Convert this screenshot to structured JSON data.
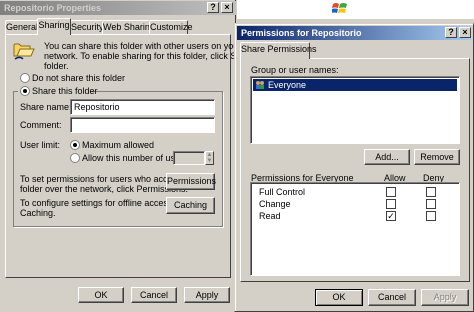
{
  "props": {
    "title": "Repositorio Properties",
    "tabs": [
      "General",
      "Sharing",
      "Security",
      "Web Sharing",
      "Customize"
    ],
    "intro": [
      "You can share this folder with other users on your",
      "network. To enable sharing for this folder, click Share this",
      "folder."
    ],
    "do_not_share": "Do not share this folder",
    "share_this": "Share this folder",
    "share_name_label": "Share name:",
    "share_name_value": "Repositorio",
    "comment_label": "Comment:",
    "comment_value": "",
    "user_limit_label": "User limit:",
    "maximum_allowed": "Maximum allowed",
    "allow_this_number": "Allow this number of users:",
    "perm_text": [
      "To set permissions for users who access this",
      "folder over the network, click Permissions."
    ],
    "permissions_button": "Permissions",
    "cache_text": [
      "To configure settings for offline access, click",
      "Caching."
    ],
    "caching_button": "Caching",
    "ok": "OK",
    "cancel": "Cancel",
    "apply": "Apply"
  },
  "perm": {
    "title": "Permissions for Repositorio",
    "tab": "Share Permissions",
    "group_label": "Group or user names:",
    "users": [
      "Everyone"
    ],
    "add_button": "Add...",
    "remove_button": "Remove",
    "perm_for_label": "Permissions for Everyone",
    "allow_header": "Allow",
    "deny_header": "Deny",
    "rows": [
      {
        "name": "Full Control",
        "allow": false,
        "deny": false
      },
      {
        "name": "Change",
        "allow": false,
        "deny": false
      },
      {
        "name": "Read",
        "allow": true,
        "deny": false
      }
    ],
    "ok": "OK",
    "cancel": "Cancel",
    "apply": "Apply"
  },
  "taskbar": {
    "windows_logo_icon": "windows-flag-icon"
  },
  "help_glyph": "?",
  "close_glyph": "×",
  "check_glyph": "✓",
  "colors": {
    "title_active": "#0a246a",
    "title_inactive": "#808080",
    "selection": "#0a246a",
    "face": "#d4d0c8"
  }
}
